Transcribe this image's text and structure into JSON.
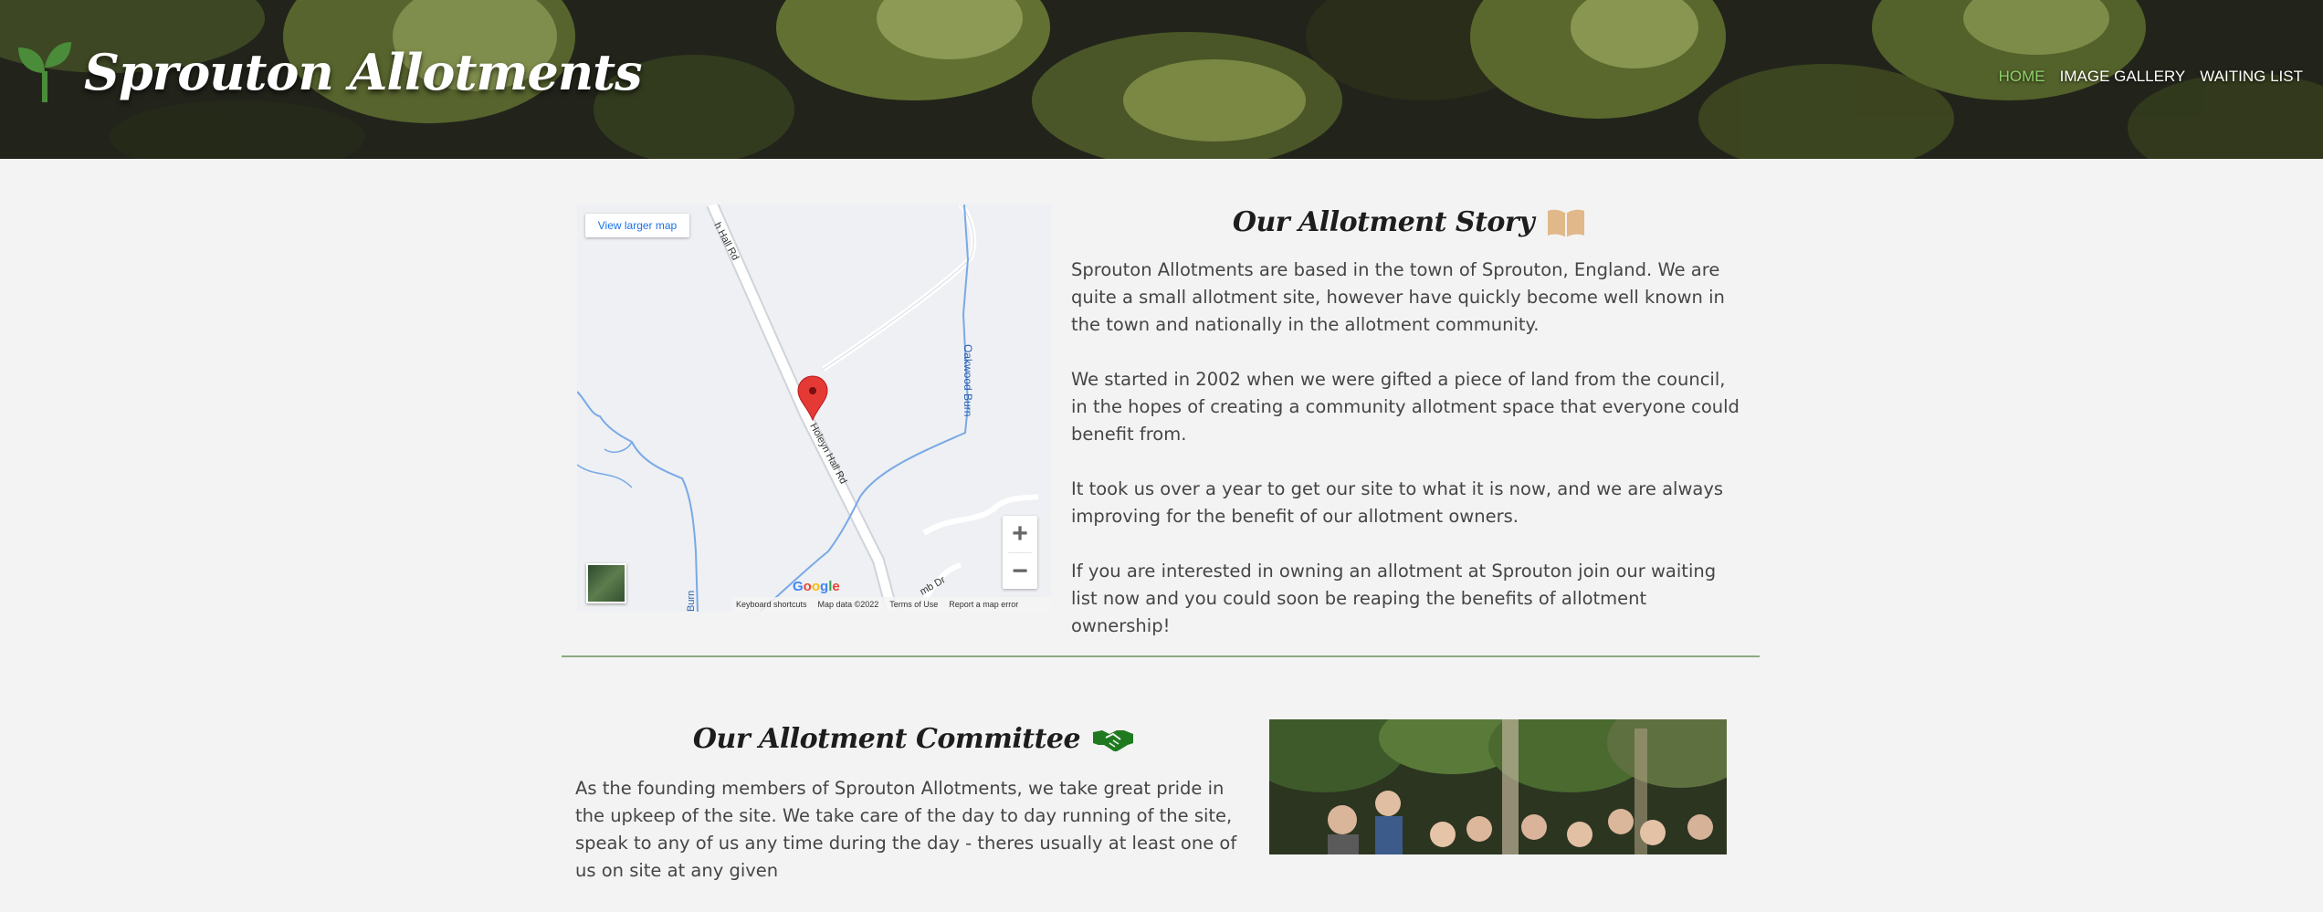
{
  "site": {
    "title": "Sprouton Allotments"
  },
  "nav": {
    "items": [
      {
        "label": "HOME",
        "active": true
      },
      {
        "label": "IMAGE GALLERY",
        "active": false
      },
      {
        "label": "WAITING LIST",
        "active": false
      }
    ]
  },
  "map": {
    "view_larger": "View larger map",
    "labels": {
      "road_top": "h Hall Rd",
      "road_main": "Holeyn Hall Rd",
      "burn": "Oakwood Burn",
      "burn_bottom": "Burn",
      "drive": "mb Dr"
    },
    "zoom_in": "+",
    "zoom_out": "−",
    "google": "Google",
    "footer": [
      "Keyboard shortcuts",
      "Map data ©2022",
      "Terms of Use",
      "Report a map error"
    ]
  },
  "story": {
    "title": "Our Allotment Story",
    "paragraphs": [
      "Sprouton Allotments are based in the town of Sprouton, England. We are quite a small allotment site, however have quickly become well known in the town and nationally in the allotment community.",
      "We started in 2002 when we were gifted a piece of land from the council, in the hopes of creating a community allotment space that everyone could benefit from.",
      "It took us over a year to get our site to what it is now, and we are always improving for the benefit of our allotment owners.",
      "If you are interested in owning an allotment at Sprouton join our waiting list now and you could soon be reaping the benefits of allotment ownership!"
    ]
  },
  "committee": {
    "title": "Our Allotment Committee",
    "paragraphs": [
      "As the founding members of Sprouton Allotments, we take great pride in the upkeep of the site. We take care of the day to day running of the site, speak to any of us any time during the day - theres usually at least one of us on site at any given"
    ]
  },
  "colors": {
    "nav_active": "#8fd16a",
    "divider": "#8faa84",
    "logo_sprout": "#4a8c3a",
    "handshake": "#1f7a1f",
    "book": "#e0b88a",
    "map_pin": "#e53935",
    "water": "#7aa9e6"
  },
  "icons": {
    "logo": "sprout-icon",
    "story": "open-book-icon",
    "committee": "handshake-icon"
  }
}
